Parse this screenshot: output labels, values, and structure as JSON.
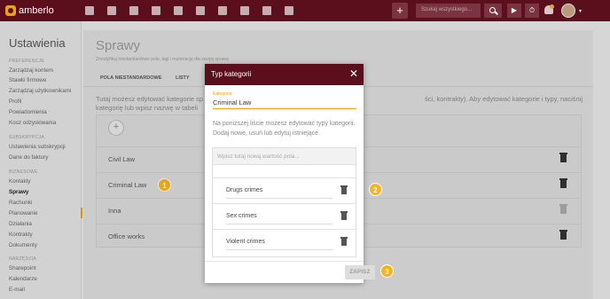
{
  "app": {
    "logo_text": "amberlo"
  },
  "topbar": {
    "nav_icons": [
      "dashboard-icon",
      "contacts-icon",
      "briefcase-icon",
      "documents-icon",
      "bank-icon",
      "tasks-icon",
      "clock-icon",
      "folder-icon",
      "mail-icon",
      "reports-icon"
    ],
    "add_label": "+",
    "search_placeholder": "Szukaj wszystkiego...",
    "play_label": "▶",
    "timer_label": "⏱",
    "caret": "▾"
  },
  "sidebar": {
    "title": "Ustawienia",
    "sections": [
      {
        "heading": "PREFERENCJE",
        "items": [
          "Zarządzaj kontem",
          "Stawki firmowe",
          "Zarządzaj użytkownikami",
          "Profil",
          "Powiadomienia",
          "Kosz odzyskiwania"
        ]
      },
      {
        "heading": "SUBSKRYPCJA",
        "items": [
          "Ustawienia subskrypcji",
          "Dane do faktury"
        ]
      },
      {
        "heading": "BIZNESOWE",
        "items": [
          "Kontakty",
          "Sprawy",
          "Rachunki",
          "Planowanie",
          "Działania",
          "Kontrakty",
          "Dokumenty"
        ]
      },
      {
        "heading": "NARZĘDZIA",
        "items": [
          "Sharepoint",
          "Kalendarze",
          "E-mail"
        ]
      }
    ],
    "active_item": "Sprawy"
  },
  "main": {
    "title": "Sprawy",
    "subtitle": "Zmodyfikuj niestandardowe pola, tagi i numerację dla swojej sprawy",
    "tabs": [
      "POLA NIESTANDARDOWE",
      "LISTY"
    ],
    "description_left": "Tutaj możesz edytować kategorie sp",
    "description_left2": "kategorię lub wpisz nazwę w tabeli",
    "description_right": "ści, kontrakty). Aby edytować kategorie i typy, naciśnij",
    "add_label": "+",
    "categories": [
      "Civil Law",
      "Criminal Law",
      "Inna",
      "Office works"
    ]
  },
  "modal": {
    "title": "Typ kategorii",
    "close": "✕",
    "field_label": "Kategoria",
    "field_value": "Criminal Law",
    "help_text": "Na poniższej liście możesz edytować typy kategorii. Dodaj nowe, usuń lub edytuj istniejące.",
    "new_value_placeholder": "Wpisz tutaj nową wartość pola...",
    "types": [
      "Drugs crimes",
      "Sex crimes",
      "Violent crimes"
    ],
    "save_label": "ZAPISZ"
  },
  "badges": [
    "1",
    "2",
    "3"
  ],
  "colors": {
    "brand": "#5b0f1c",
    "accent": "#f5b51e"
  }
}
